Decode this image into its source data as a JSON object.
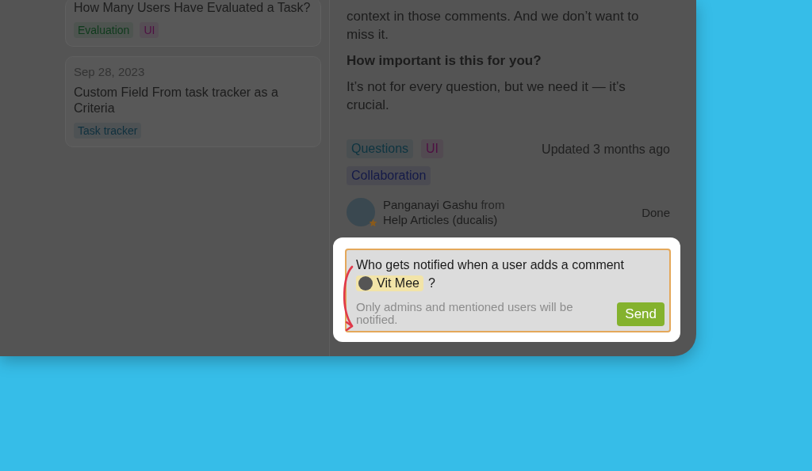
{
  "left_cards": [
    {
      "title": "How Many Users Have Evaluated a Task?",
      "tags": [
        {
          "label": "Evaluation",
          "color": "#0f3a1c"
        },
        {
          "label": "UI",
          "color": "#4e1042"
        }
      ]
    },
    {
      "date": "Sep 28, 2023",
      "title": "Custom Field From task tracker as a Criteria",
      "tags": [
        {
          "label": "Task tracker",
          "color": "#10303e"
        }
      ]
    }
  ],
  "post": {
    "paragraph": "context in those comments. And we don’t want to miss it.",
    "heading": "How important is this for you?",
    "body": "It’s not for every question, but we need it — it’s crucial.",
    "tags": [
      {
        "label": "Questions",
        "color": "#0e3440"
      },
      {
        "label": "UI",
        "color": "#4e1042"
      },
      {
        "label": "Collaboration",
        "color": "#141a48"
      }
    ],
    "updated": "Updated 3 months ago"
  },
  "author": {
    "name": "Panganayi Gashu",
    "from": "from",
    "source": "Help Articles (ducalis)",
    "status": "Done"
  },
  "comment": {
    "text": "Who gets notified when a user adds a comment",
    "mention": "Vit Mee",
    "suffix": "?",
    "hint": "Only admins and mentioned users will be notified.",
    "send": "Send"
  }
}
